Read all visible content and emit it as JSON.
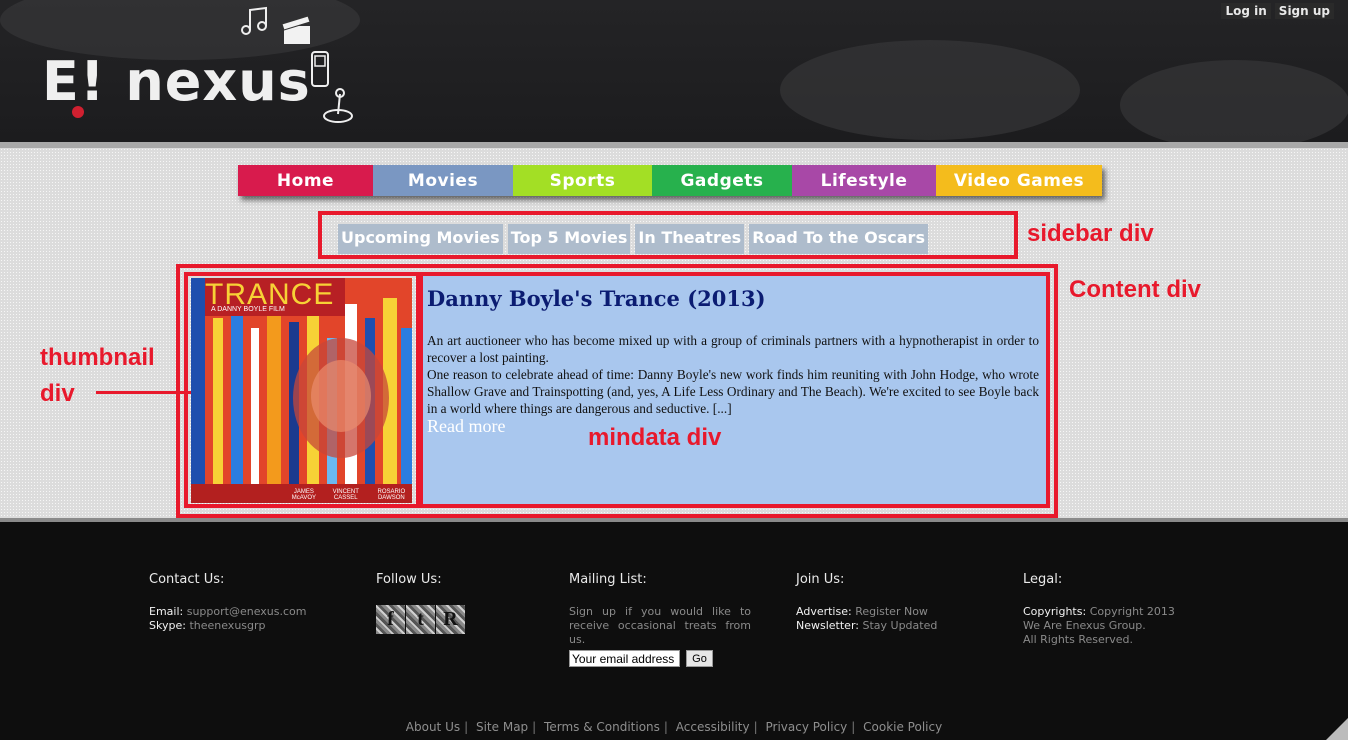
{
  "header": {
    "logo_text": "E! nexus",
    "auth": {
      "login": "Log in",
      "signup": "Sign up"
    }
  },
  "nav": {
    "items": [
      {
        "label": "Home",
        "color": "#d81b4d"
      },
      {
        "label": "Movies",
        "color": "#7a97c2"
      },
      {
        "label": "Sports",
        "color": "#a3df25"
      },
      {
        "label": "Gadgets",
        "color": "#27b14d"
      },
      {
        "label": "Lifestyle",
        "color": "#a848a7"
      },
      {
        "label": "Video Games",
        "color": "#f4bc1c"
      }
    ]
  },
  "subnav": {
    "items": [
      {
        "label": "Upcoming Movies"
      },
      {
        "label": "Top 5 Movies"
      },
      {
        "label": "In Theatres"
      },
      {
        "label": "Road To the Oscars"
      }
    ]
  },
  "annotations": {
    "sidebar": "sidebar div",
    "content": "Content div",
    "thumbnail_line1": "thumbnail",
    "thumbnail_line2": "div",
    "mindata": "mindata div"
  },
  "poster": {
    "title": "TRANCE",
    "subtitle": "A DANNY BOYLE FILM",
    "credits": [
      "JAMES McAVOY",
      "VINCENT CASSEL",
      "ROSARIO DAWSON"
    ]
  },
  "article": {
    "title": "Danny Boyle's Trance (2013)",
    "para1": "An art auctioneer who has become mixed up with a group of criminals partners with a hypnotherapist in order to recover a lost painting.",
    "para2": "One reason to celebrate ahead of time: Danny Boyle's new work finds him reuniting with John Hodge, who wrote Shallow Grave and Trainspotting (and, yes, A Life Less Ordinary and The Beach). We're excited to see Boyle back in a world where things are dangerous and seductive. [...]",
    "read_more": "Read more"
  },
  "footer": {
    "contact": {
      "heading": "Contact Us:",
      "email_label": "Email:",
      "email": "support@enexus.com",
      "skype_label": "Skype:",
      "skype": "theenexusgrp"
    },
    "follow": {
      "heading": "Follow Us:",
      "icons": [
        "f",
        "t",
        "R"
      ]
    },
    "mailing": {
      "heading": "Mailing List:",
      "text": "Sign up if you would like to receive occasional treats from us.",
      "input_value": "Your email address",
      "button": "Go"
    },
    "join": {
      "heading": "Join Us:",
      "advertise_label": "Advertise:",
      "advertise": "Register Now",
      "newsletter_label": "Newsletter:",
      "newsletter": "Stay Updated"
    },
    "legal": {
      "heading": "Legal:",
      "copyright_label": "Copyrights:",
      "copyright": "Copyright 2013",
      "line2": "We Are Enexus Group.",
      "line3": "All Rights Reserved."
    },
    "links": [
      "About Us",
      "Site Map",
      "Terms & Conditions",
      "Accessibility",
      "Privacy Policy",
      "Cookie Policy"
    ]
  }
}
